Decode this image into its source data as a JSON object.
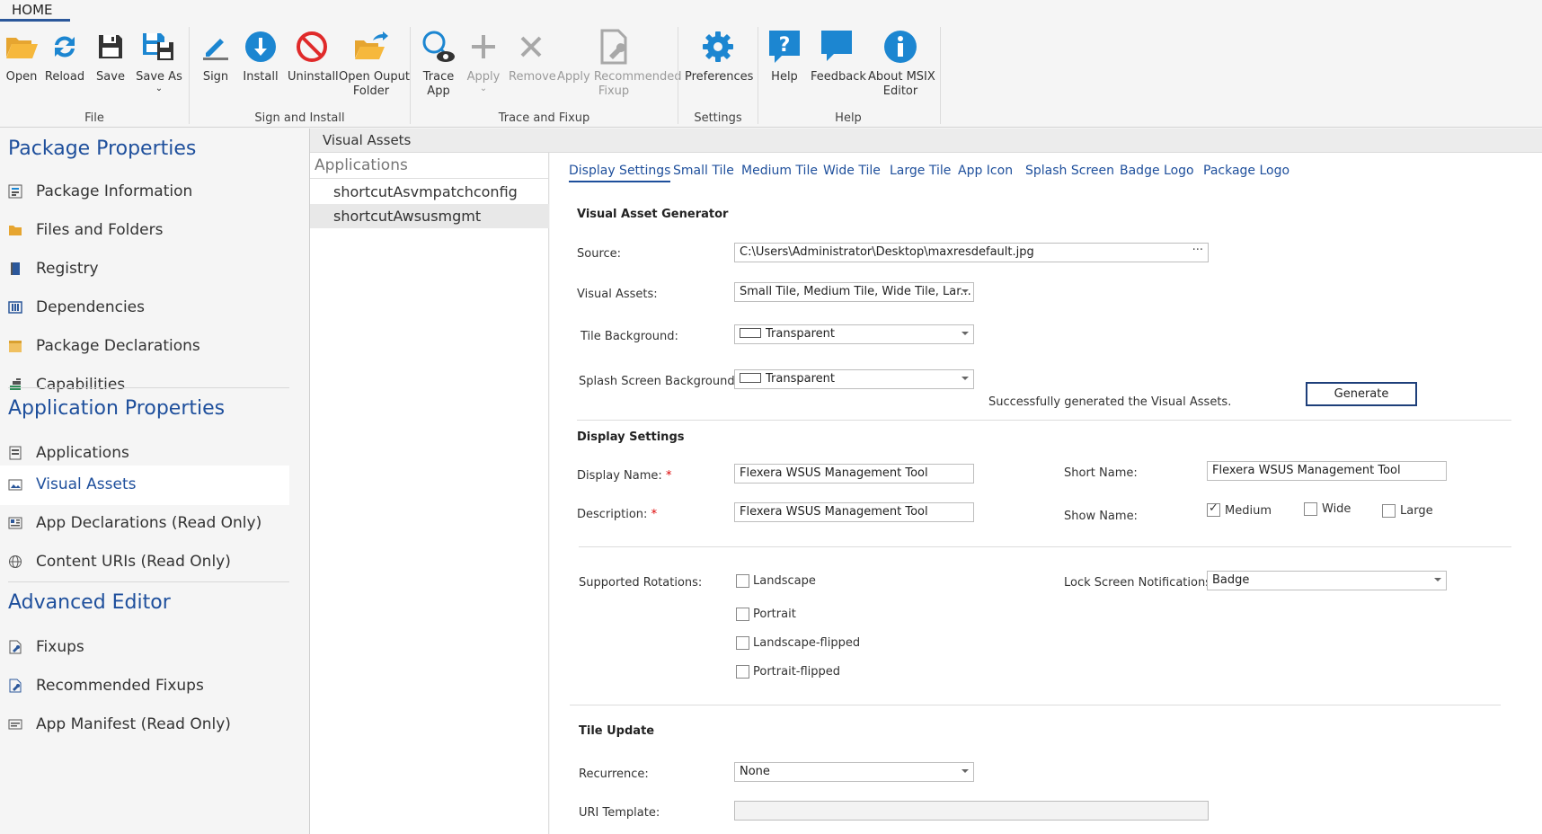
{
  "ribbon": {
    "tab": "HOME",
    "groups": {
      "file": "File",
      "sign_install": "Sign and Install",
      "trace_fixup": "Trace and Fixup",
      "settings": "Settings",
      "help": "Help"
    },
    "buttons": {
      "open": "Open",
      "reload": "Reload",
      "save": "Save",
      "save_as": "Save As",
      "sign": "Sign",
      "install": "Install",
      "uninstall": "Uninstall",
      "open_output_1": "Open Ouput",
      "open_output_2": "Folder",
      "trace_1": "Trace",
      "trace_2": "App",
      "apply": "Apply",
      "remove": "Remove",
      "apply_rec_1": "Apply Recommended",
      "apply_rec_2": "Fixup",
      "preferences": "Preferences",
      "help": "Help",
      "feedback": "Feedback",
      "about_1": "About MSIX",
      "about_2": "Editor"
    }
  },
  "nav": {
    "package_properties": "Package Properties",
    "package_information": "Package Information",
    "files_and_folders": "Files and Folders",
    "registry": "Registry",
    "dependencies": "Dependencies",
    "package_declarations": "Package Declarations",
    "capabilities": "Capabilities",
    "application_properties": "Application Properties",
    "applications": "Applications",
    "visual_assets": "Visual Assets",
    "app_declarations": "App Declarations (Read Only)",
    "content_uris": "Content URIs (Read Only)",
    "advanced_editor": "Advanced Editor",
    "fixups": "Fixups",
    "recommended_fixups": "Recommended Fixups",
    "app_manifest": "App Manifest (Read Only)"
  },
  "header": {
    "title": "Visual Assets"
  },
  "apps": {
    "header": "Applications",
    "items": [
      "shortcutAsvmpatchconfig",
      "shortcutAwsusmgmt"
    ]
  },
  "tabs": [
    "Display Settings",
    "Small Tile",
    "Medium Tile",
    "Wide Tile",
    "Large Tile",
    "App Icon",
    "Splash Screen",
    "Badge Logo",
    "Package Logo"
  ],
  "generator": {
    "heading": "Visual Asset Generator",
    "source_label": "Source:",
    "source_value": "C:\\Users\\Administrator\\Desktop\\maxresdefault.jpg",
    "source_browse": "···",
    "assets_label": "Visual Assets:",
    "assets_value": "Small Tile, Medium Tile, Wide Tile, Lar...",
    "tile_bg_label": "Tile Background:",
    "tile_bg_value": "Transparent",
    "splash_bg_label": "Splash Screen Background:",
    "splash_bg_value": "Transparent",
    "status": "Successfully generated the Visual Assets.",
    "generate": "Generate"
  },
  "display": {
    "heading": "Display Settings",
    "display_name_label": "Display Name:",
    "display_name_value": "Flexera WSUS Management Tool",
    "description_label": "Description:",
    "description_value": "Flexera WSUS Management Tool",
    "short_name_label": "Short Name:",
    "short_name_value": "Flexera WSUS Management Tool",
    "show_name_label": "Show Name:",
    "medium": "Medium",
    "wide": "Wide",
    "large": "Large",
    "required": "*"
  },
  "rotations": {
    "label": "Supported Rotations:",
    "landscape": "Landscape",
    "portrait": "Portrait",
    "landscape_flipped": "Landscape-flipped",
    "portrait_flipped": "Portrait-flipped",
    "lock_label": "Lock Screen Notifications:",
    "lock_value": "Badge"
  },
  "tile_update": {
    "heading": "Tile Update",
    "recurrence_label": "Recurrence:",
    "recurrence_value": "None",
    "uri_label": "URI Template:",
    "uri_value": ""
  }
}
